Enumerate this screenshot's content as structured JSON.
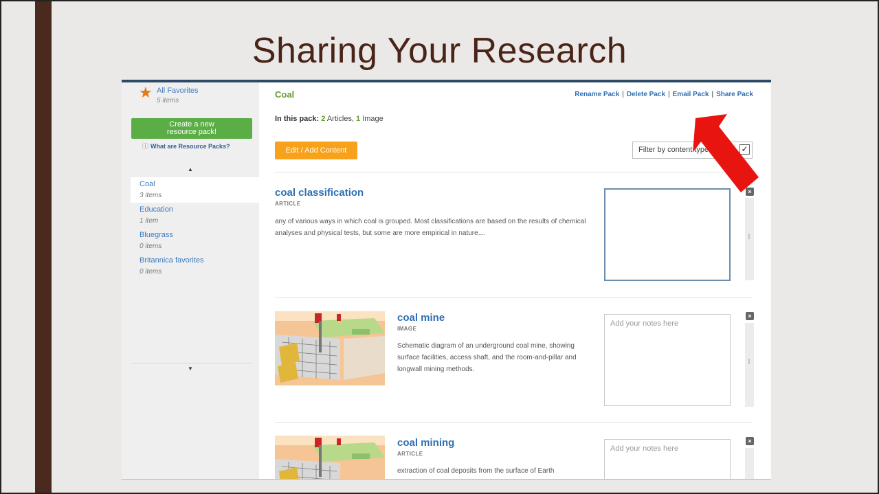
{
  "slide": {
    "title": "Sharing Your Research"
  },
  "sidebar": {
    "favorites": {
      "label": "All Favorites",
      "count": "5 items"
    },
    "create_button": {
      "line1": "Create a new",
      "line2": "resource pack!"
    },
    "help_link": "What are Resource Packs?",
    "packs": [
      {
        "name": "Coal",
        "count": "3 items",
        "active": true
      },
      {
        "name": "Education",
        "count": "1 item",
        "active": false
      },
      {
        "name": "Bluegrass",
        "count": "0 items",
        "active": false
      },
      {
        "name": "Britannica favorites",
        "count": "0 items",
        "active": false
      }
    ]
  },
  "pack": {
    "title": "Coal",
    "actions": [
      "Rename Pack",
      "Delete Pack",
      "Email Pack",
      "Share Pack"
    ],
    "summary": {
      "prefix": "In this pack:",
      "articles_count": "2",
      "articles_label": "Articles,",
      "images_count": "1",
      "images_label": "Image"
    },
    "edit_button": "Edit / Add Content",
    "filter_label": "Filter by content type"
  },
  "items": [
    {
      "title": "coal classification",
      "type": "ARTICLE",
      "description": "any of various ways in which coal is grouped. Most classifications are based on the results of chemical analyses and physical tests, but some are more empirical in nature....",
      "notes_placeholder": ""
    },
    {
      "title": "coal mine",
      "type": "IMAGE",
      "description": "Schematic diagram of an underground coal mine, showing surface facilities, access shaft, and the room-and-pillar and longwall mining methods.",
      "notes_placeholder": "Add your notes here"
    },
    {
      "title": "coal mining",
      "type": "ARTICLE",
      "description": "extraction of coal deposits from the surface of Earth",
      "notes_placeholder": "Add your notes here"
    }
  ],
  "colors": {
    "accent_bar": "#4a2a1e",
    "title": "#4a2418",
    "link_blue": "#2f6fb4",
    "green": "#5aae45",
    "orange": "#f7a21a",
    "arrow_red": "#e8140f"
  }
}
